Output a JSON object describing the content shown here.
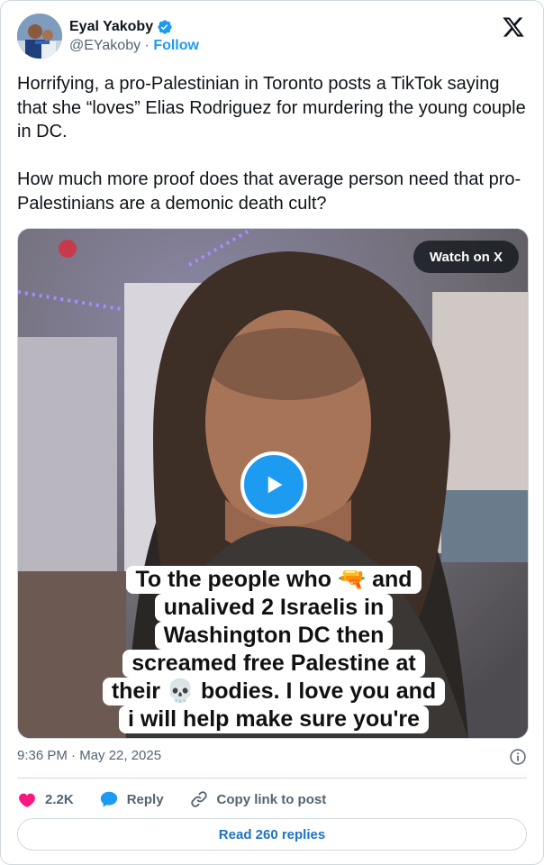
{
  "author": {
    "name": "Eyal Yakoby",
    "handle": "@EYakoby",
    "separator": " · ",
    "follow_label": "Follow",
    "verified_icon": "verified-badge-icon",
    "brand_icon": "x-logo-icon"
  },
  "tweet": {
    "text": "Horrifying, a pro-Palestinian in Toronto posts a TikTok saying that she “loves” Elias Rodriguez for murdering the young couple in DC.\n\nHow much more proof does that average person need that pro-Palestinians are a demonic death cult?"
  },
  "media": {
    "watch_label": "Watch on X",
    "play_icon": "play-icon",
    "caption_lines": [
      "To the people who 🔫 and",
      "unalived 2 Israelis in",
      "Washington DC then",
      "screamed free Palestine at",
      "their 💀 bodies. I love you and",
      "i will help make sure you're"
    ]
  },
  "meta": {
    "timestamp": "9:36 PM · May 22, 2025",
    "info_icon": "info-icon"
  },
  "actions": {
    "like_count": "2.2K",
    "reply_label": "Reply",
    "copy_label": "Copy link to post"
  },
  "footer": {
    "read_replies": "Read 260 replies"
  },
  "colors": {
    "accent": "#1d9bf0",
    "like": "#f91880",
    "text": "#0f1419",
    "muted": "#536471",
    "border": "#cfd9de"
  }
}
